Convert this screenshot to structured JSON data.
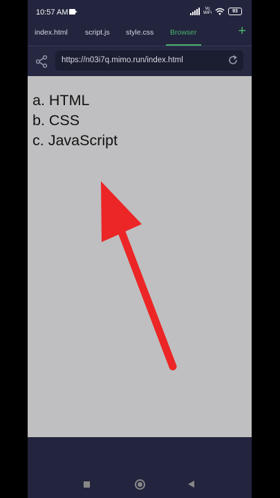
{
  "status_bar": {
    "time": "10:57 AM",
    "network_label": "Vo\nWiFi",
    "battery": "93"
  },
  "tabs": [
    {
      "label": "index.html"
    },
    {
      "label": "script.js"
    },
    {
      "label": "style.css"
    },
    {
      "label": "Browser",
      "active": true
    }
  ],
  "address_bar": {
    "url": "https://n03i7q.mimo.run/index.html"
  },
  "page": {
    "list_items": [
      "a. HTML",
      "b. CSS",
      "c. JavaScript"
    ]
  },
  "annotation": {
    "arrow_color": "#ec2626"
  },
  "colors": {
    "accent": "#49b36c",
    "background": "#262842",
    "viewport": "#bfbfc1"
  }
}
